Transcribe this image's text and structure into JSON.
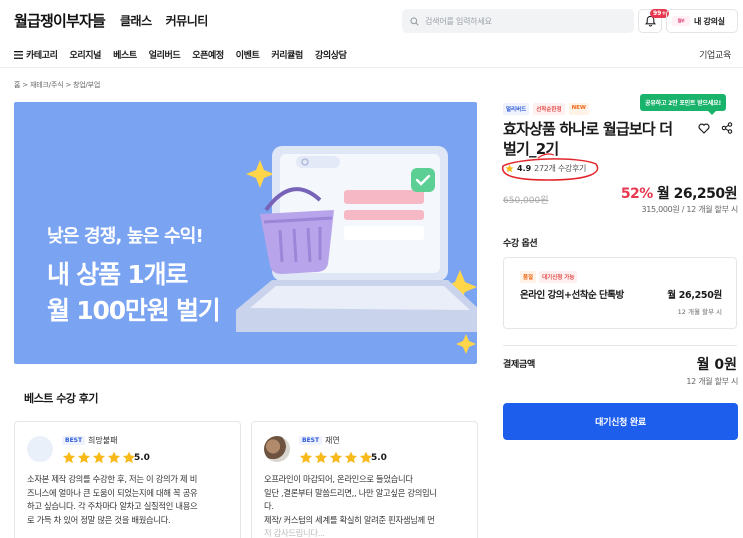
{
  "header": {
    "logo": "월급쟁이부자들",
    "nav": [
      "클래스",
      "커뮤니티"
    ],
    "search_placeholder": "검색어를 입력하세요",
    "bell_badge": "99+",
    "my_class": "내 강의실",
    "my_class_logo": "월부"
  },
  "subnav": {
    "category": "카테고리",
    "items": [
      "오리지널",
      "베스트",
      "얼리버드",
      "오픈예정",
      "이벤트",
      "커리큘럼",
      "강의상담"
    ],
    "biz": "기업교육"
  },
  "breadcrumb": "홈 > 재테크/주식 > 창업/부업",
  "banner": {
    "line1": "낮은 경쟁, 높은 수익!",
    "line2": "내 상품 1개로",
    "line3": "월 100만원 벌기"
  },
  "reviews": {
    "title": "베스트 수강 후기",
    "items": [
      {
        "badge": "BEST",
        "nick": "희망불패",
        "score": "5.0",
        "lines": [
          "소자본 제작 강의를 수강한 후, 저는 이 강의가 제 비",
          "즈니스에 얼마나 큰 도움이 되었는지에 대해 꼭 공유",
          "하고 싶습니다. 각 주차마다 알차고 실질적인 내용으",
          "로 가득 차 있어 정말 많은 것을 배웠습니다."
        ]
      },
      {
        "badge": "BEST",
        "nick": "재연",
        "score": "5.0",
        "lines": [
          "오프라인이 마감되어, 온라인으로 들었습니다",
          "일단 ,결론부터 말씀드리면,, 나만 알고싶은 강의입니",
          "다.",
          "제작/ 커스텀의 세계를 확실히 알려준 핀자샘님께 먼",
          "저 감사드립니다..."
        ]
      }
    ]
  },
  "product": {
    "tags": [
      "얼리버드",
      "선착순한정",
      "NEW"
    ],
    "share_tip": "공유하고 2만 포인트 받으세요!",
    "title": "효자상품 하나로 월급보다 더 벌기_2기",
    "rating": "4.9",
    "review_count": "272개 수강후기",
    "original_price": "650,000원",
    "discount": "52%",
    "price": "월 26,250원",
    "installment": "315,000원 / 12 개월 할부 시"
  },
  "options": {
    "section_title": "수강 옵션",
    "tags": [
      "품절",
      "대기신청 가능"
    ],
    "name": "온라인 강의+선착순 단톡방",
    "price": "월 26,250원",
    "installment": "12 개월 할부 시"
  },
  "payment": {
    "label": "결제금액",
    "total": "월 0원",
    "installment": "12 개월 할부 시",
    "cta": "대기신청 완료"
  },
  "colors": {
    "brand_blue": "#1d5eec",
    "banner_bg": "#7aa3f2",
    "discount_red": "#e8384f",
    "star_yellow": "#f8b91b",
    "tip_green": "#19b36b"
  }
}
